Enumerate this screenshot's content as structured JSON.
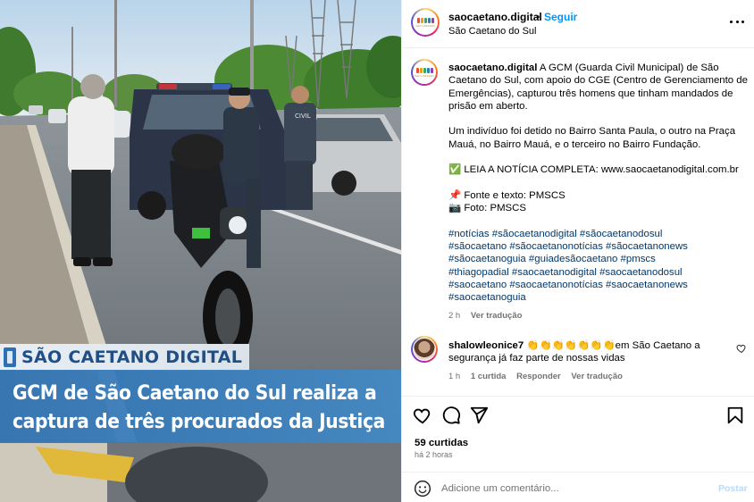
{
  "post": {
    "image_brand": "SÃO CAETANO DIGITAL",
    "image_headline": [
      "GCM de São Caetano do Sul realiza a",
      "captura de três procurados da Justiça"
    ]
  },
  "header": {
    "username": "saocaetano.digital",
    "separator": "•",
    "follow_label": "Seguir",
    "location": "São Caetano do Sul"
  },
  "caption": {
    "username": "saocaetano.digital",
    "lines": [
      " A GCM (Guarda Civil Municipal) de São",
      "Caetano do Sul, com apoio do CGE (Centro de Gerenciamento de",
      "Emergências), capturou três homens que tinham mandados de",
      "prisão em aberto.",
      "",
      "Um indivíduo foi detido no Bairro Santa Paula, o outro na Praça",
      "Mauá, no Bairro Mauá, e o terceiro no Bairro Fundação.",
      "",
      "✅ LEIA A NOTÍCIA COMPLETA: www.saocaetanodigital.com.br",
      "",
      "📌 Fonte e texto: PMSCS",
      "📷 Foto: PMSCS",
      ""
    ],
    "hashtag_lines": [
      "#notícias #sãocaetanodigital #sãocaetanodosul",
      "#sãocaetano #sãocaetanonotícias #sãocaetanonews",
      "#sãocaetanoguia #guiadesãocaetano #pmscs",
      "#thiagopadial #saocaetanodigital #saocaetanodosul",
      "#saocaetano #saocaetanonotícias #saocaetanonews",
      "#saocaetanoguia"
    ],
    "time": "2 h",
    "translate_label": "Ver tradução"
  },
  "comment": {
    "username": "shalowleonice7",
    "text_line1": " 👏👏👏👏👏👏👏em São Caetano a",
    "text_line2": "segurança já faz parte de nossas vidas",
    "time": "1 h",
    "likes": "1 curtida",
    "reply_label": "Responder",
    "translate_label": "Ver tradução"
  },
  "actions": {
    "likes": "59 curtidas",
    "posted_ago": "há 2 horas"
  },
  "add_comment": {
    "placeholder": "Adicione um comentário...",
    "post_label": "Postar"
  },
  "colors": {
    "link_blue": "#0095f6",
    "hashtag": "#00376b",
    "muted": "#737373",
    "headline_bg": "#2f73b4"
  }
}
